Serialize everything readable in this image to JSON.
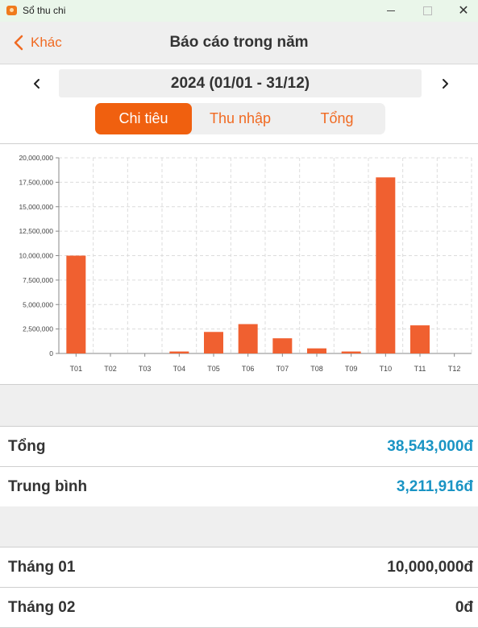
{
  "window": {
    "title": "Sổ thu chi"
  },
  "nav": {
    "back_label": "Khác",
    "title": "Báo cáo trong năm"
  },
  "period": {
    "label": "2024 (01/01 - 31/12)"
  },
  "segments": [
    {
      "label": "Chi tiêu",
      "active": true
    },
    {
      "label": "Thu nhập",
      "active": false
    },
    {
      "label": "Tổng",
      "active": false
    }
  ],
  "colors": {
    "accent": "#f0600f",
    "bar": "#f06030",
    "value_blue": "#1a94c4"
  },
  "chart_data": {
    "type": "bar",
    "categories": [
      "T01",
      "T02",
      "T03",
      "T04",
      "T05",
      "T06",
      "T07",
      "T08",
      "T09",
      "T10",
      "T11",
      "T12"
    ],
    "values": [
      10000000,
      0,
      0,
      200000,
      2200000,
      3000000,
      1550000,
      520000,
      200000,
      18000000,
      2873000,
      0
    ],
    "ylim": [
      0,
      20000000
    ],
    "yticks": [
      "0",
      "2,500,000",
      "5,000,000",
      "7,500,000",
      "10,000,000",
      "12,500,000",
      "15,000,000",
      "17,500,000",
      "20,000,000"
    ],
    "ytick_values": [
      0,
      2500000,
      5000000,
      7500000,
      10000000,
      12500000,
      15000000,
      17500000,
      20000000
    ],
    "grid": true
  },
  "summary": {
    "total_label": "Tổng",
    "total_value": "38,543,000đ",
    "average_label": "Trung bình",
    "average_value": "3,211,916đ"
  },
  "months": [
    {
      "label": "Tháng 01",
      "value": "10,000,000đ"
    },
    {
      "label": "Tháng 02",
      "value": "0đ"
    }
  ]
}
